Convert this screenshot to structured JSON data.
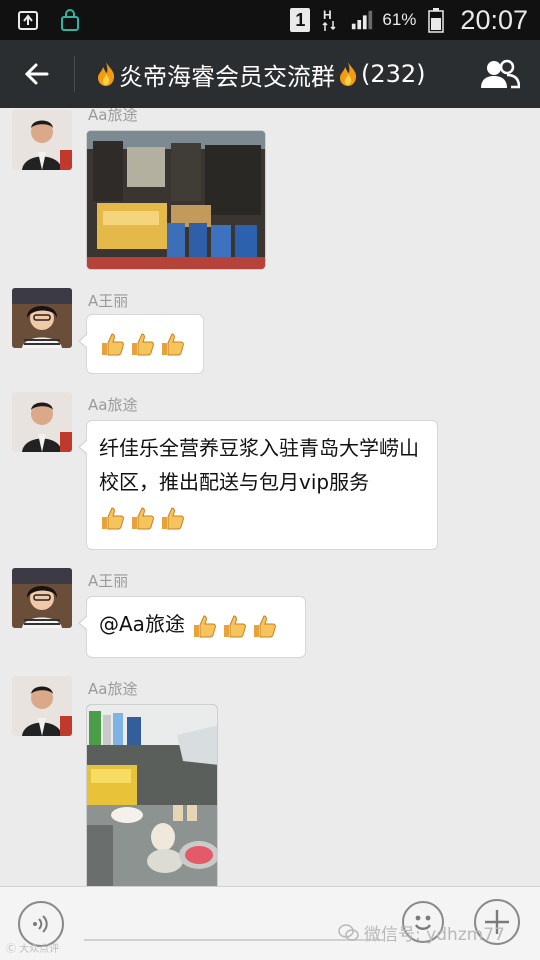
{
  "status_bar": {
    "sim_label": "1",
    "battery_percent": "61%",
    "time": "20:07"
  },
  "title_bar": {
    "title": "炎帝海睿会员交流群",
    "member_count": "(232)"
  },
  "messages": [
    {
      "sender": "Aa旅途",
      "type": "image"
    },
    {
      "sender": "A王丽",
      "type": "text",
      "thumbs": 3
    },
    {
      "sender": "Aa旅途",
      "type": "text",
      "text": "纤佳乐全营养豆浆入驻青岛大学崂山校区，推出配送与包月vip服务",
      "thumbs": 3
    },
    {
      "sender": "A王丽",
      "type": "text",
      "text": "@Aa旅途 ",
      "thumbs": 3
    },
    {
      "sender": "Aa旅途",
      "type": "image"
    }
  ],
  "colors": {
    "title_bar": "#2b2e30",
    "status_bar": "#111111",
    "chat_background": "#ebebeb",
    "bubble": "#ffffff"
  },
  "icons": {
    "back": "arrow-left-icon",
    "members": "group-icon",
    "voice": "voice-icon",
    "emoji": "emoji-icon",
    "more": "plus-icon"
  },
  "watermark": {
    "text": "微信号: ydhzm77",
    "corner_text": "Ⓒ 大众点评"
  }
}
